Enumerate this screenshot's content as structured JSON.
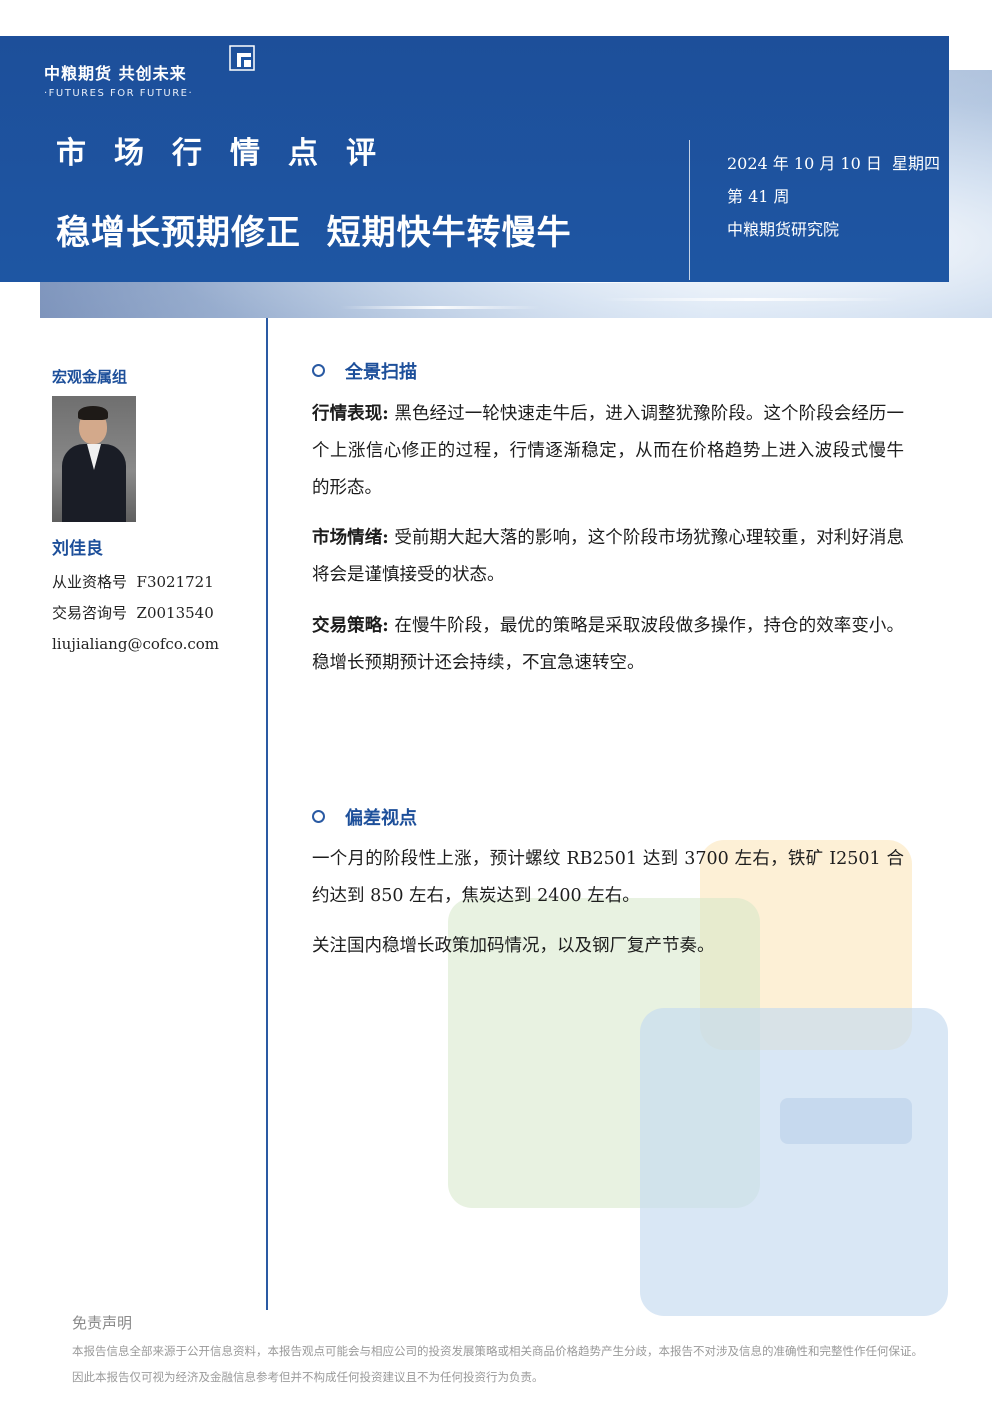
{
  "header": {
    "logo_cn": "中粮期货 共创未来",
    "logo_en": "·FUTURES FOR FUTURE·",
    "kicker": "市场行情点评",
    "title": "稳增长预期修正  短期快牛转慢牛",
    "date": "2024 年 10 月 10 日  星期四",
    "week": "第 41 周",
    "institute": "中粮期货研究院"
  },
  "sidebar": {
    "group": "宏观金属组",
    "name": "刘佳良",
    "qualification": "从业资格号  F3021721",
    "consulting": "交易咨询号  Z0013540",
    "email": "liujialiang@cofco.com"
  },
  "sections": [
    {
      "heading": "全景扫描",
      "paragraphs": [
        {
          "lead": "行情表现:",
          "text": " 黑色经过一轮快速走牛后，进入调整犹豫阶段。这个阶段会经历一个上涨信心修正的过程，行情逐渐稳定，从而在价格趋势上进入波段式慢牛的形态。"
        },
        {
          "lead": "市场情绪:",
          "text": " 受前期大起大落的影响，这个阶段市场犹豫心理较重，对利好消息将会是谨慎接受的状态。"
        },
        {
          "lead": "交易策略:",
          "text": " 在慢牛阶段，最优的策略是采取波段做多操作，持仓的效率变小。稳增长预期预计还会持续，不宜急速转空。"
        }
      ]
    },
    {
      "heading": "偏差视点",
      "paragraphs": [
        {
          "lead": "",
          "text": "一个月的阶段性上涨，预计螺纹 RB2501 达到 3700 左右，铁矿 I2501 合约达到 850 左右，焦炭达到 2400 左右。"
        },
        {
          "lead": "",
          "text": "关注国内稳增长政策加码情况，以及钢厂复产节奏。"
        }
      ]
    }
  ],
  "footer": {
    "title": "免责声明",
    "text": "本报告信息全部来源于公开信息资料，本报告观点可能会与相应公司的投资发展策略或相关商品价格趋势产生分歧，本报告不对涉及信息的准确性和完整性作任何保证。因此本报告仅可视为经济及金融信息参考但并不构成任何投资建议且不为任何投资行为负责。"
  },
  "colors": {
    "brand_blue": "#1e56a3",
    "accent_blue": "#2a5aa3"
  }
}
